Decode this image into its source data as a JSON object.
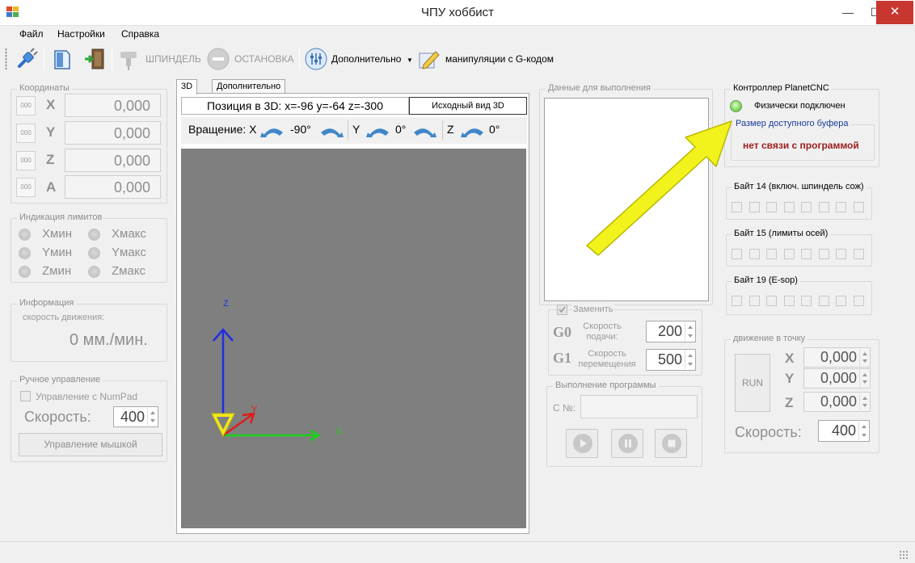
{
  "window": {
    "title": "ЧПУ хоббист",
    "minimize": "—",
    "maximize": "☐",
    "close": "✕"
  },
  "menu": {
    "file": "Файл",
    "settings": "Настройки",
    "help": "Справка"
  },
  "toolbar": {
    "spindle": "ШПИНДЕЛЬ",
    "stop": "ОСТАНОВКА",
    "additional": "Дополнительно",
    "gcode": "манипуляции с G-кодом"
  },
  "coords": {
    "title": "Координаты",
    "zero_label": "000",
    "axes": [
      {
        "letter": "X",
        "value": "0,000"
      },
      {
        "letter": "Y",
        "value": "0,000"
      },
      {
        "letter": "Z",
        "value": "0,000"
      },
      {
        "letter": "A",
        "value": "0,000"
      }
    ]
  },
  "limits": {
    "title": "Индикация лимитов",
    "items": [
      "Xмин",
      "Xмакс",
      "Yмин",
      "Yмакс",
      "Zмин",
      "Zмакс"
    ]
  },
  "info": {
    "title": "Информация",
    "speed_label": "скорость движения:",
    "speed_value": "0 мм./мин."
  },
  "manual": {
    "title": "Ручное управление",
    "numpad": "Управление с NumPad",
    "speed_label": "Скорость:",
    "speed_value": "400",
    "mouse": "Управление мышкой"
  },
  "view3d": {
    "tab_3d": "3D",
    "tab_extra": "Дополнительно",
    "position": "Позиция в 3D: x=-96 y=-64 z=-300",
    "reset": "Исходный вид 3D",
    "rotation_label": "Вращение: X",
    "rot_x": "-90°",
    "y_label": "Y",
    "rot_y": "0°",
    "z_label": "Z",
    "rot_z": "0°",
    "axis_x": "X",
    "axis_y": "Y",
    "axis_z": "Z"
  },
  "exec_data": {
    "title": "Данные для выполнения"
  },
  "replace": {
    "title": "Заменить",
    "g0": "G0",
    "g0_label": "Скорость подачи:",
    "g0_value": "200",
    "g1": "G1",
    "g1_label": "Скорость перемещения",
    "g1_value": "500"
  },
  "program": {
    "title": "Выполнение программы",
    "line_label": "С №:"
  },
  "controller": {
    "title": "Контроллер PlanetCNC",
    "status": "Физически подключен",
    "buffer_title": "Размер доступного буфера",
    "buffer_value": "нет связи с программой",
    "byte14": "Байт 14 (включ. шпиндель сож)",
    "byte15": "Байт 15 (лимиты осей)",
    "byte19": "Байт 19 (E-sop)"
  },
  "moveto": {
    "title": "движение в точку",
    "run": "RUN",
    "x": "X",
    "x_value": "0,000",
    "y": "Y",
    "y_value": "0,000",
    "z": "Z",
    "z_value": "0,000",
    "speed_label": "Скорость:",
    "speed_value": "400"
  },
  "colors": {
    "led_green": "#7bd053",
    "buffer_text": "#9b1c1c",
    "arrow": "#f2f21c",
    "accent_blue": "#1b3c9a"
  }
}
